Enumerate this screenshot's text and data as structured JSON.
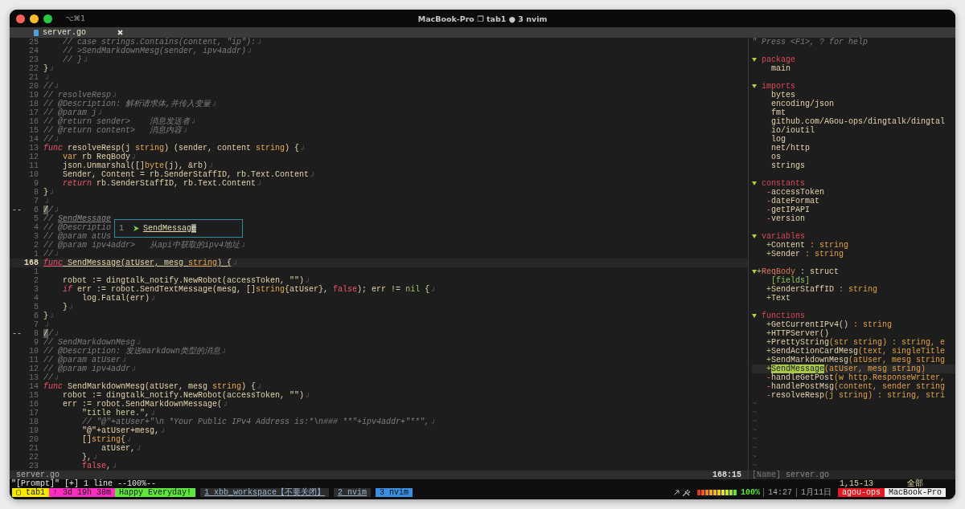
{
  "window": {
    "shortcut": "⌥⌘1",
    "title": "MacBook-Pro ❐ tab1 ● 3 nvim"
  },
  "tabline": {
    "tabs": [
      {
        "label": "server.go",
        "selected": true
      }
    ]
  },
  "code": {
    "lines": [
      {
        "num": "25",
        "current": false,
        "eol": true,
        "segs": [
          {
            "kind": "comment",
            "t": "    // case strings.Contains(content, \"ip\"):"
          }
        ]
      },
      {
        "num": "24",
        "current": false,
        "eol": true,
        "segs": [
          {
            "kind": "comment",
            "t": "    // >SendMarkdownMesg(sender, ipv4addr)"
          }
        ]
      },
      {
        "num": "23",
        "current": false,
        "eol": true,
        "segs": [
          {
            "kind": "comment",
            "t": "    // }"
          }
        ]
      },
      {
        "num": "22",
        "current": false,
        "eol": true,
        "segs": [
          {
            "kind": "plain",
            "t": "}"
          }
        ]
      },
      {
        "num": "21",
        "current": false,
        "eol": true
      },
      {
        "num": "20",
        "current": false,
        "eol": true,
        "segs": [
          {
            "kind": "comment",
            "t": "//"
          }
        ]
      },
      {
        "num": "19",
        "current": false,
        "eol": true,
        "segs": [
          {
            "kind": "comment",
            "t": "// resolveResp"
          }
        ]
      },
      {
        "num": "18",
        "current": false,
        "eol": true,
        "segs": [
          {
            "kind": "comment",
            "t": "// @Description: 解析请求体,并传入变量"
          }
        ]
      },
      {
        "num": "17",
        "current": false,
        "eol": true,
        "segs": [
          {
            "kind": "comment",
            "t": "// @param j"
          }
        ]
      },
      {
        "num": "16",
        "current": false,
        "eol": true,
        "segs": [
          {
            "kind": "comment",
            "t": "// @return sender>    消息发送者"
          }
        ]
      },
      {
        "num": "15",
        "current": false,
        "eol": true,
        "segs": [
          {
            "kind": "comment",
            "t": "// @return content>   消息内容"
          }
        ]
      },
      {
        "num": "14",
        "current": false,
        "eol": true,
        "segs": [
          {
            "kind": "comment",
            "t": "//"
          }
        ]
      },
      {
        "num": "13",
        "current": false,
        "eol": true,
        "segs": [
          {
            "kind": "keyword",
            "t": "func"
          },
          {
            "kind": "plain",
            "t": " resolveResp(j "
          },
          {
            "kind": "type",
            "t": "string"
          },
          {
            "kind": "plain",
            "t": ") (sender, content "
          },
          {
            "kind": "type",
            "t": "string"
          },
          {
            "kind": "plain",
            "t": ") {"
          }
        ]
      },
      {
        "num": "12",
        "current": false,
        "eol": true,
        "segs": [
          {
            "kind": "type",
            "t": "    var"
          },
          {
            "kind": "plain",
            "t": " rb ReqBody"
          }
        ]
      },
      {
        "num": "11",
        "current": false,
        "eol": true,
        "segs": [
          {
            "kind": "plain",
            "t": "    json.Unmarshal([]"
          },
          {
            "kind": "type",
            "t": "byte"
          },
          {
            "kind": "plain",
            "t": "(j), &rb)"
          }
        ]
      },
      {
        "num": "10",
        "current": false,
        "eol": true,
        "segs": [
          {
            "kind": "plain",
            "t": "    Sender, Content = rb.SenderStaffID, rb.Text.Content"
          }
        ]
      },
      {
        "num": "9",
        "current": false,
        "eol": true,
        "segs": [
          {
            "kind": "keyword",
            "t": "    return"
          },
          {
            "kind": "plain",
            "t": " rb.SenderStaffID, rb.Text.Content"
          }
        ]
      },
      {
        "num": "8",
        "current": false,
        "eol": true,
        "segs": [
          {
            "kind": "plain",
            "t": "}"
          }
        ]
      },
      {
        "num": "7",
        "current": false,
        "eol": true
      },
      {
        "num": "6",
        "sign": "--",
        "current": false,
        "eol": true,
        "segs": [
          {
            "kind": "mark",
            "t": "/"
          },
          {
            "kind": "comment",
            "t": "/"
          }
        ]
      },
      {
        "num": "5",
        "current": false,
        "eol": false,
        "segs": [
          {
            "kind": "comment",
            "t": "// "
          },
          {
            "kind": "link",
            "t": "SendMessage"
          }
        ]
      },
      {
        "num": "4",
        "current": false,
        "eol": false,
        "segs": [
          {
            "kind": "comment",
            "t": "// @Descriptio"
          }
        ]
      },
      {
        "num": "3",
        "current": false,
        "eol": false,
        "segs": [
          {
            "kind": "comment",
            "t": "// @param atUs"
          }
        ]
      },
      {
        "num": "2",
        "current": false,
        "eol": true,
        "segs": [
          {
            "kind": "comment",
            "t": "// @param ipv4addr>   从api中获取的ipv4地址"
          }
        ]
      },
      {
        "num": "1",
        "current": false,
        "eol": true,
        "segs": [
          {
            "kind": "comment",
            "t": "//"
          }
        ]
      },
      {
        "num": "168",
        "current": true,
        "eol": true,
        "segs": [
          {
            "kind": "keyword",
            "t": "func"
          },
          {
            "kind": "plain",
            "t": " SendMessage(atUser, mesg "
          },
          {
            "kind": "type",
            "t": "string"
          },
          {
            "kind": "plain",
            "t": ") {"
          }
        ]
      },
      {
        "num": "1",
        "current": false,
        "eol": false
      },
      {
        "num": "2",
        "current": false,
        "eol": true,
        "segs": [
          {
            "kind": "plain",
            "t": "    robot := dingtalk_notify.NewRobot(accessToken, \"\")"
          }
        ]
      },
      {
        "num": "3",
        "current": false,
        "eol": true,
        "segs": [
          {
            "kind": "keyword",
            "t": "    if"
          },
          {
            "kind": "plain",
            "t": " err := robot.SendTextMessage(mesg, []"
          },
          {
            "kind": "type",
            "t": "string"
          },
          {
            "kind": "plain",
            "t": "{atUser}, "
          },
          {
            "kind": "boolean",
            "t": "false"
          },
          {
            "kind": "plain",
            "t": "); err != "
          },
          {
            "kind": "nil",
            "t": "nil"
          },
          {
            "kind": "plain",
            "t": " {"
          }
        ]
      },
      {
        "num": "4",
        "current": false,
        "eol": true,
        "segs": [
          {
            "kind": "plain",
            "t": "        log.Fatal(err)"
          }
        ]
      },
      {
        "num": "5",
        "current": false,
        "eol": true,
        "segs": [
          {
            "kind": "plain",
            "t": "    }"
          }
        ]
      },
      {
        "num": "6",
        "current": false,
        "eol": true,
        "segs": [
          {
            "kind": "plain",
            "t": "}"
          }
        ]
      },
      {
        "num": "7",
        "current": false,
        "eol": true
      },
      {
        "num": "8",
        "sign": "--",
        "current": false,
        "eol": true,
        "segs": [
          {
            "kind": "mark",
            "t": "/"
          },
          {
            "kind": "comment",
            "t": "/"
          }
        ]
      },
      {
        "num": "9",
        "current": false,
        "eol": true,
        "segs": [
          {
            "kind": "comment",
            "t": "// SendMarkdownMesg"
          }
        ]
      },
      {
        "num": "10",
        "current": false,
        "eol": true,
        "segs": [
          {
            "kind": "comment",
            "t": "// @Description: 发送markdown类型的消息"
          }
        ]
      },
      {
        "num": "11",
        "current": false,
        "eol": true,
        "segs": [
          {
            "kind": "comment",
            "t": "// @param atUser"
          }
        ]
      },
      {
        "num": "12",
        "current": false,
        "eol": true,
        "segs": [
          {
            "kind": "comment",
            "t": "// @param ipv4addr"
          }
        ]
      },
      {
        "num": "13",
        "current": false,
        "eol": true,
        "segs": [
          {
            "kind": "comment",
            "t": "//"
          }
        ]
      },
      {
        "num": "14",
        "current": false,
        "eol": true,
        "segs": [
          {
            "kind": "keyword",
            "t": "func"
          },
          {
            "kind": "plain",
            "t": " SendMarkdownMesg(atUser, mesg "
          },
          {
            "kind": "type",
            "t": "string"
          },
          {
            "kind": "plain",
            "t": ") {"
          }
        ]
      },
      {
        "num": "15",
        "current": false,
        "eol": true,
        "segs": [
          {
            "kind": "plain",
            "t": "    robot := dingtalk_notify.NewRobot(accessToken, \"\")"
          }
        ]
      },
      {
        "num": "16",
        "current": false,
        "eol": true,
        "segs": [
          {
            "kind": "plain",
            "t": "    err := robot.SendMarkdownMessage("
          }
        ]
      },
      {
        "num": "17",
        "current": false,
        "eol": true,
        "segs": [
          {
            "kind": "string",
            "t": "        \"title here.\""
          },
          {
            "kind": "plain",
            "t": ","
          }
        ]
      },
      {
        "num": "18",
        "current": false,
        "eol": true,
        "segs": [
          {
            "kind": "comment",
            "t": "        // \"@\"+atUser+\"\\n *Your Public IPv4 Address is:*\\n### **\"+ipv4addr+\"**\","
          }
        ]
      },
      {
        "num": "19",
        "current": false,
        "eol": true,
        "segs": [
          {
            "kind": "plain",
            "t": "        \"@\"+atUser+mesg,"
          }
        ]
      },
      {
        "num": "20",
        "current": false,
        "eol": true,
        "segs": [
          {
            "kind": "plain",
            "t": "        []"
          },
          {
            "kind": "type",
            "t": "string"
          },
          {
            "kind": "plain",
            "t": "{"
          }
        ]
      },
      {
        "num": "21",
        "current": false,
        "eol": true,
        "segs": [
          {
            "kind": "plain",
            "t": "            atUser,"
          }
        ]
      },
      {
        "num": "22",
        "current": false,
        "eol": true,
        "segs": [
          {
            "kind": "plain",
            "t": "        },"
          }
        ]
      },
      {
        "num": "23",
        "current": false,
        "eol": true,
        "segs": [
          {
            "kind": "boolean",
            "t": "        false"
          },
          {
            "kind": "plain",
            "t": ","
          }
        ]
      }
    ]
  },
  "completion_popup": {
    "items": [
      {
        "index": "1",
        "label": "SendMessage",
        "selected": true
      }
    ]
  },
  "outline": {
    "help": "\" Press <F1>, ? for help",
    "nodes": [
      {
        "kind": "section",
        "label": "package",
        "expanded": true,
        "children": [
          {
            "name": "main"
          }
        ]
      },
      {
        "kind": "section",
        "label": "imports",
        "expanded": true,
        "children": [
          {
            "name": "bytes"
          },
          {
            "name": "encoding/json"
          },
          {
            "name": "fmt"
          },
          {
            "name": "github.com/AGou-ops/dingtalk/dingtal"
          },
          {
            "name": "io/ioutil"
          },
          {
            "name": "log"
          },
          {
            "name": "net/http"
          },
          {
            "name": "os"
          },
          {
            "name": "strings"
          }
        ]
      },
      {
        "kind": "section",
        "label": "constants",
        "expanded": true,
        "children": [
          {
            "vis": "-",
            "name": "accessToken"
          },
          {
            "vis": "-",
            "name": "dateFormat"
          },
          {
            "vis": "-",
            "name": "getIPAPI"
          },
          {
            "vis": "-",
            "name": "version"
          }
        ]
      },
      {
        "kind": "section",
        "label": "variables",
        "expanded": true,
        "children": [
          {
            "vis": "+",
            "name": "Content",
            "detail": " : string"
          },
          {
            "vis": "+",
            "name": "Sender",
            "detail": " : string"
          }
        ]
      },
      {
        "kind": "struct",
        "vis": "+",
        "label": "ReqBody",
        "detail": " : struct",
        "expanded": true,
        "children": [
          {
            "kind": "group",
            "name": "[fields]"
          },
          {
            "vis": "+",
            "name": "SenderStaffID",
            "detail": " : string"
          },
          {
            "vis": "+",
            "name": "Text"
          }
        ]
      },
      {
        "kind": "section",
        "label": "functions",
        "expanded": true,
        "children": [
          {
            "vis": "+",
            "name": "GetCurrentIPv4()",
            "detail": " : string",
            "selected": false
          },
          {
            "vis": "+",
            "name": "HTTPServer()",
            "selected": false
          },
          {
            "vis": "+",
            "name": "PrettyString",
            "detail": "(str string) : string, e",
            "selected": false
          },
          {
            "vis": "+",
            "name": "SendActionCardMesg",
            "detail": "(text, singleTitle",
            "selected": false
          },
          {
            "vis": "+",
            "name": "SendMarkdownMesg",
            "detail": "(atUser, mesg string",
            "selected": false
          },
          {
            "vis": "+",
            "name": "SendMessage",
            "detail": "(atUser, mesg string)",
            "selected": true
          },
          {
            "vis": "-",
            "name": "handleGetPost",
            "detail": "(w http.ResponseWriter,",
            "selected": false
          },
          {
            "vis": "-",
            "name": "handlePostMsg",
            "detail": "(content, sender string",
            "selected": false
          },
          {
            "vis": "-",
            "name": "resolveResp",
            "detail": "(j string) : string, stri",
            "selected": false
          }
        ]
      }
    ],
    "filler": [
      "~",
      "~",
      "~",
      "~",
      "~",
      "~",
      "~",
      "~"
    ]
  },
  "status": {
    "file": "server.go",
    "position": "168:15",
    "outline_tag": "[Name]",
    "outline_file": "server.go"
  },
  "command_line": {
    "message": "\"[Prompt]\" [+] 1 line --100%--",
    "ruler": "1,15-13",
    "scroll": "全部"
  },
  "tmux": {
    "segments": [
      {
        "text": "▢ tab1",
        "color": "#f7ea00"
      },
      {
        "text": "↑ 3d 19h 38m",
        "color": "#ff2cc0"
      },
      {
        "text": "Happy Everyday!",
        "color": "#5fe83b"
      }
    ],
    "windows": [
      {
        "label": "1 xbb_workspace【不要关闭】",
        "selected": false
      },
      {
        "label": "2 nvim",
        "selected": false
      },
      {
        "label": "3 nvim",
        "selected": true
      }
    ],
    "battery": {
      "level": 1,
      "reading": "100%"
    },
    "time": "14:27",
    "date": "1月11日",
    "session": "agou-ops",
    "host": "MacBook-Pro"
  }
}
